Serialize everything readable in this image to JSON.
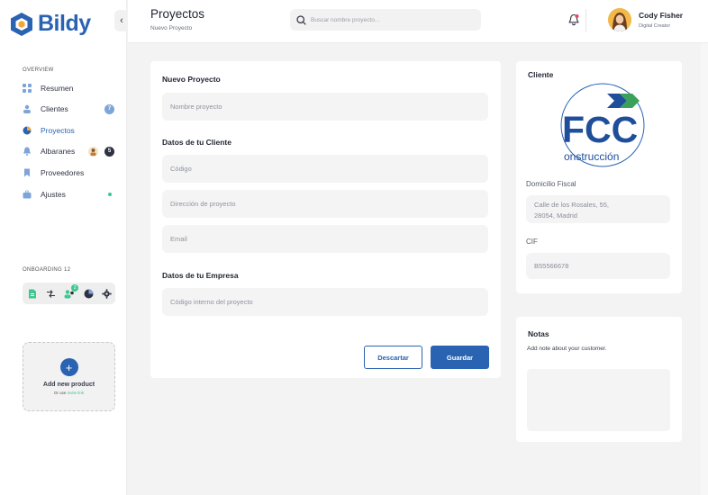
{
  "app": {
    "brand": "Bildy",
    "brand_color": "#2a63b2",
    "accent_green": "#3cc88f"
  },
  "sidebar": {
    "collapse_icon": "chevron-left-icon",
    "overview_label": "OVERVIEW",
    "items": [
      {
        "label": "Resumen",
        "icon": "grid-icon",
        "active": false
      },
      {
        "label": "Clientes",
        "icon": "users-icon",
        "active": false,
        "badge": "7"
      },
      {
        "label": "Proyectos",
        "icon": "pie-icon",
        "active": true
      },
      {
        "label": "Albaranes",
        "icon": "bell-icon",
        "active": false,
        "badge": "5"
      },
      {
        "label": "Proveedores",
        "icon": "bookmark-icon",
        "active": false
      },
      {
        "label": "Ajustes",
        "icon": "briefcase-icon",
        "active": false,
        "status_dot": true
      }
    ],
    "onboarding_label": "ONBOARDING",
    "onboarding_count": "12",
    "onboarding_badge": "2",
    "add_product": {
      "plus": "+",
      "title": "Add new product",
      "sub_prefix": "Or use",
      "sub_link": "invite link"
    }
  },
  "header": {
    "title": "Proyectos",
    "breadcrumb": "Nuevo Proyecto",
    "search_placeholder": "Buscar nombre proyecto...",
    "user_name": "Cody Fisher",
    "user_role": "Digital Creator"
  },
  "form": {
    "section_project": "Nuevo Proyecto",
    "project_name_placeholder": "Nombre proyecto",
    "section_client": "Datos de tu Cliente",
    "code_placeholder": "Código",
    "address_placeholder": "Dirección de proyecto",
    "email_placeholder": "Email",
    "section_company": "Datos de tu Empresa",
    "internal_code_placeholder": "Código interno del proyecto",
    "discard_label": "Descartar",
    "save_label": "Guardar"
  },
  "client": {
    "title": "Cliente",
    "logo_text": "FCC",
    "logo_subtext": "onstrucción",
    "fiscal_label": "Domicilio Fiscal",
    "fiscal_line1": "Calle de los Rosales, 55,",
    "fiscal_line2": "28054, Madrid",
    "cif_label": "CIF",
    "cif_value": "B55566678"
  },
  "notes": {
    "title": "Notas",
    "subtitle": "Add note about your customer."
  }
}
